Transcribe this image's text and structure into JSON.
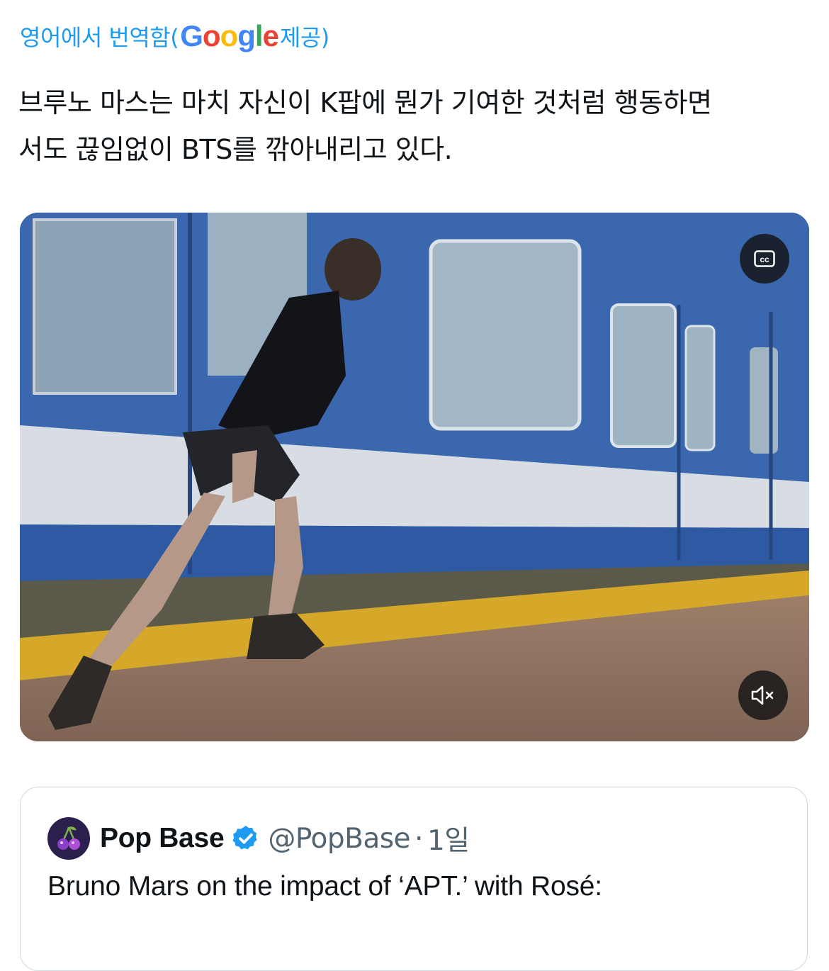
{
  "translation": {
    "prefix": "영어에서 번역함(",
    "google_letters": [
      {
        "ch": "G",
        "color": "#4285f4"
      },
      {
        "ch": "o",
        "color": "#ea4335"
      },
      {
        "ch": "o",
        "color": "#fbbc05"
      },
      {
        "ch": "g",
        "color": "#4285f4"
      },
      {
        "ch": "l",
        "color": "#34a853"
      },
      {
        "ch": "e",
        "color": "#ea4335"
      }
    ],
    "suffix": " 제공)"
  },
  "tweet": {
    "text_line1": "브루노 마스는 마치 자신이 K팝에 뭔가 기여한 것처럼 행동하면",
    "text_line2": "서도 끊임없이 BTS를 깎아내리고 있다."
  },
  "media": {
    "cc_icon": "closed-captions-icon",
    "mute_icon": "muted-speaker-icon"
  },
  "quoted": {
    "avatar_icon": "cherry-avatar-icon",
    "name": "Pop Base",
    "verified_icon": "verified-badge-icon",
    "handle": "@PopBase",
    "separator": "·",
    "time": "1일",
    "text": "Bruno Mars on the impact of ‘APT.’ with Rosé:"
  },
  "colors": {
    "link_blue": "#1d9bf0",
    "secondary_text": "#536471",
    "border": "#cfd9de"
  }
}
